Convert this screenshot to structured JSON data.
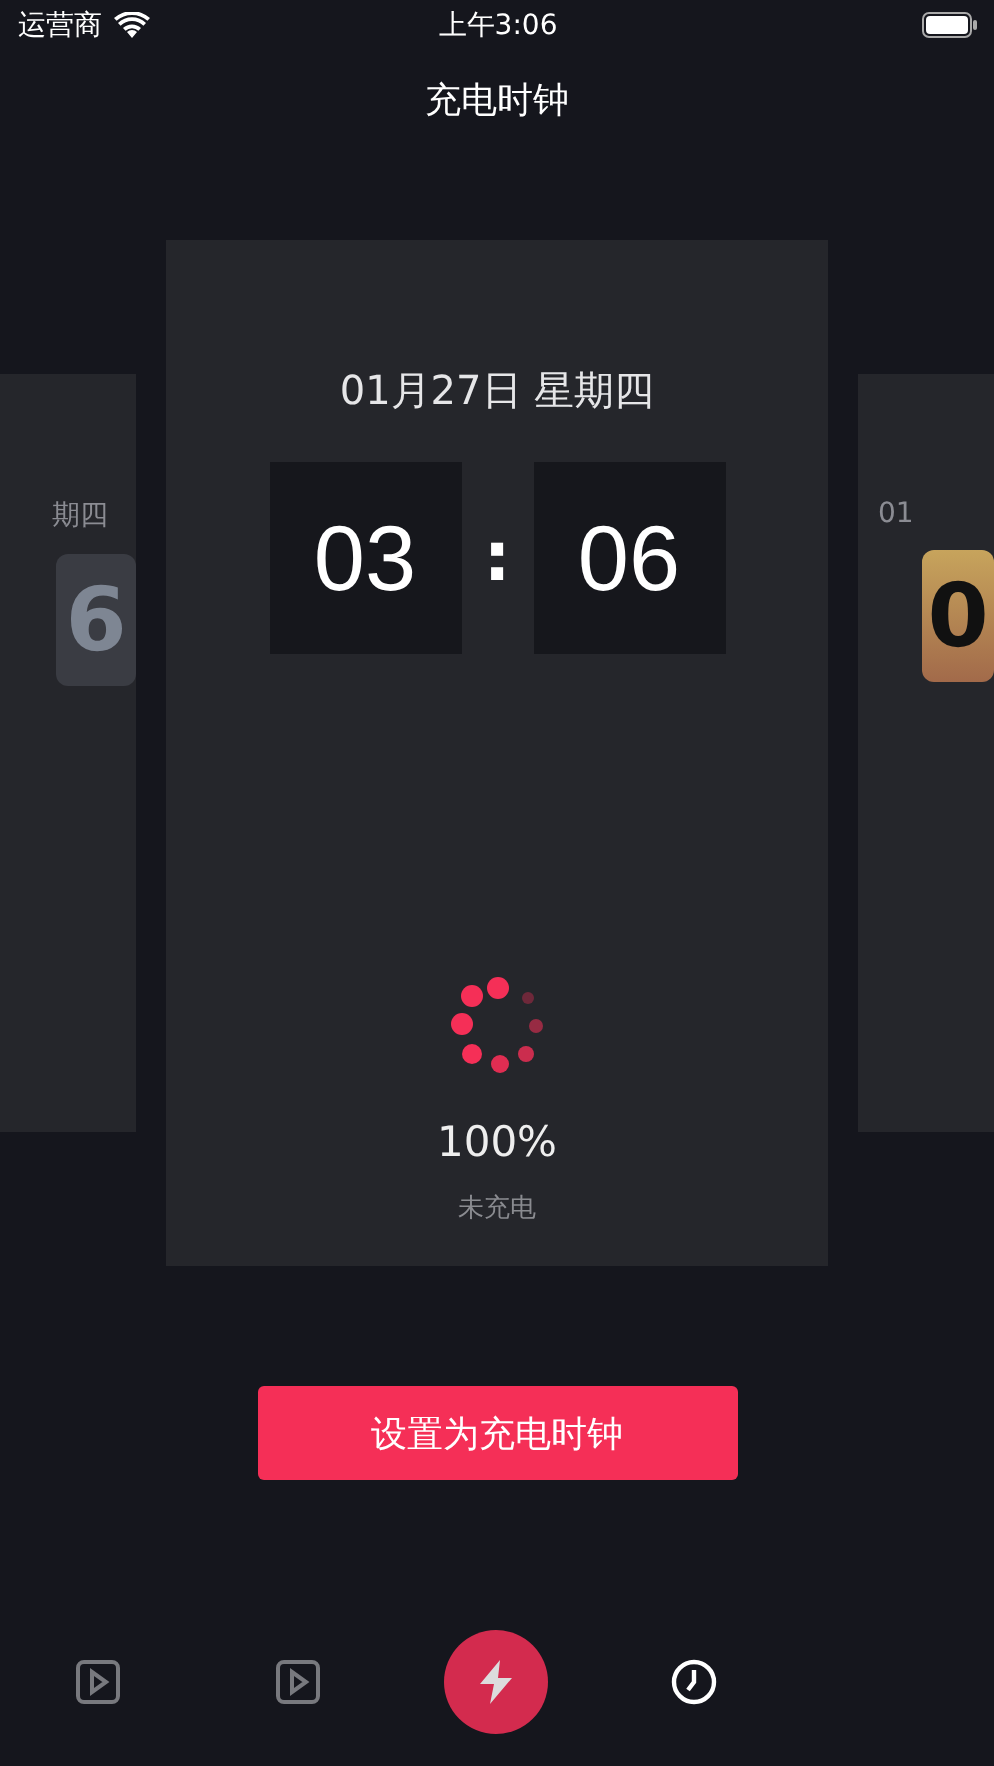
{
  "status_bar": {
    "carrier": "运营商",
    "time": "上午3:06"
  },
  "title": "充电时钟",
  "cards": [
    {
      "kind": "side-dark",
      "date": "期四",
      "digit": "6"
    },
    {
      "kind": "main",
      "date": "01月27日 星期四",
      "hours": "03",
      "separator": ":",
      "minutes": "06",
      "percent": "100%",
      "charge_state": "未充电"
    },
    {
      "kind": "side-gold",
      "date": "01",
      "digit": "0"
    }
  ],
  "set_button": "设置为充电时钟",
  "tabs": [
    {
      "kind": "play",
      "selected": false
    },
    {
      "kind": "play",
      "selected": false
    },
    {
      "kind": "bolt",
      "selected": false
    },
    {
      "kind": "clock",
      "selected": true
    }
  ]
}
